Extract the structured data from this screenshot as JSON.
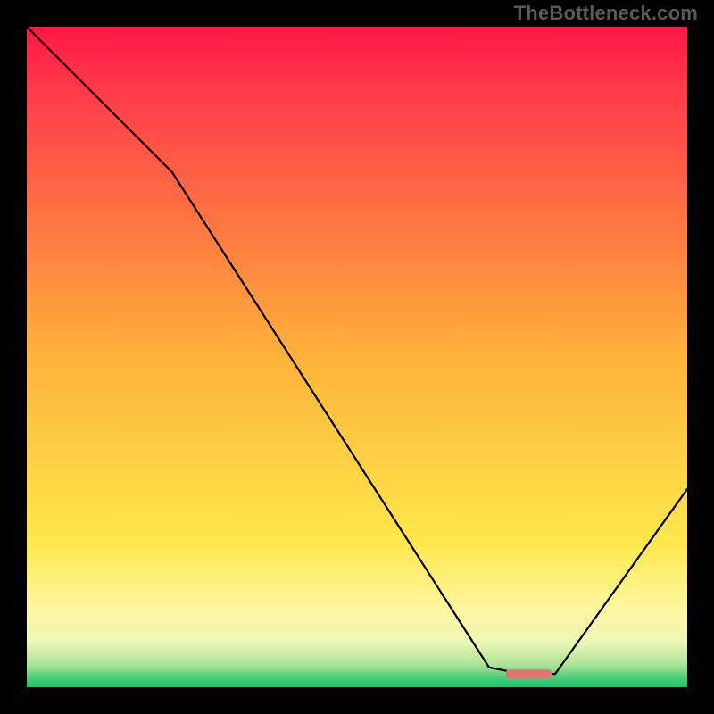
{
  "watermark": "TheBottleneck.com",
  "chart_data": {
    "type": "line",
    "title": "",
    "xlabel": "",
    "ylabel": "",
    "xlim": [
      0,
      100
    ],
    "ylim": [
      0,
      100
    ],
    "series": [
      {
        "name": "bottleneck-curve",
        "x": [
          0,
          22,
          70,
          75,
          80,
          100
        ],
        "values": [
          100,
          78,
          3,
          2,
          2,
          30
        ]
      }
    ],
    "marker": {
      "name": "optimum-marker",
      "x_center": 76,
      "y": 2,
      "width": 7,
      "color": "#e57373"
    },
    "background": {
      "type": "vertical-gradient",
      "stops": [
        {
          "pos": 0.0,
          "color": "#ff1744"
        },
        {
          "pos": 0.1,
          "color": "#ff3b4a"
        },
        {
          "pos": 0.5,
          "color": "#ffb23a"
        },
        {
          "pos": 0.78,
          "color": "#ffe84c"
        },
        {
          "pos": 0.88,
          "color": "#fff6a0"
        },
        {
          "pos": 0.93,
          "color": "#f0f8b8"
        },
        {
          "pos": 0.965,
          "color": "#aee59b"
        },
        {
          "pos": 0.985,
          "color": "#4dcf7a"
        },
        {
          "pos": 1.0,
          "color": "#17c86a"
        }
      ]
    }
  }
}
